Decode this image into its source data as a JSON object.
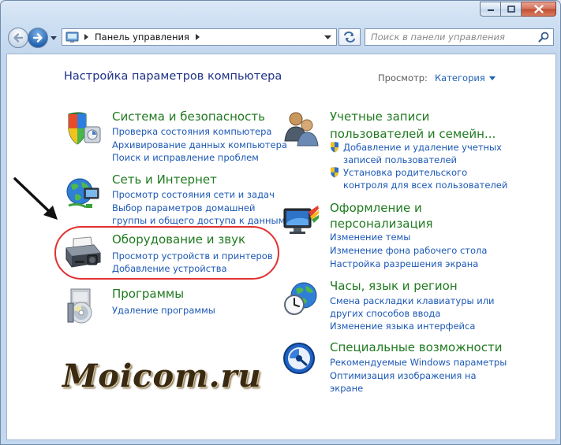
{
  "nav": {
    "address": "Панель управления",
    "search_placeholder": "Поиск в панели управления"
  },
  "header": {
    "title": "Настройка параметров компьютера",
    "viewby_label": "Просмотр:",
    "viewby_value": "Категория"
  },
  "left": [
    {
      "title": "Система и безопасность",
      "icon": "security-shield-icon",
      "links": [
        "Проверка состояния компьютера",
        "Архивирование данных компьютера",
        "Поиск и исправление проблем"
      ]
    },
    {
      "title": "Сеть и Интернет",
      "icon": "network-globe-icon",
      "links": [
        "Просмотр состояния сети и задач",
        "Выбор параметров домашней",
        "группы и общего доступа к данным"
      ]
    },
    {
      "title": "Оборудование и звук",
      "icon": "printer-icon",
      "links": [
        "Просмотр устройств и принтеров",
        "Добавление устройства"
      ]
    },
    {
      "title": "Программы",
      "icon": "programs-disc-icon",
      "links": [
        "Удаление программы"
      ]
    }
  ],
  "right": [
    {
      "title_lines": [
        "Учетные записи",
        "пользователей и семейн..."
      ],
      "icon": "users-icon",
      "links": [
        "Добавление и удаление учетных",
        "записей пользователей",
        "Установка родительского",
        "контроля для всех пользователей"
      ]
    },
    {
      "title_lines": [
        "Оформление и",
        "персонализация"
      ],
      "icon": "display-personalization-icon",
      "links": [
        "Изменение темы",
        "Изменение фона рабочего стола",
        "Настройка разрешения экрана"
      ]
    },
    {
      "title": "Часы, язык и регион",
      "icon": "clock-globe-icon",
      "links": [
        "Смена раскладки клавиатуры или",
        "других способов ввода",
        "Изменение языка интерфейса"
      ]
    },
    {
      "title": "Специальные возможности",
      "icon": "accessibility-icon",
      "links": [
        "Рекомендуемые Windows параметры",
        "Оптимизация изображения на",
        "экране"
      ]
    }
  ],
  "watermark": "Moicom.ru",
  "colors": {
    "category_title": "#207a20",
    "link": "#1c58b5",
    "header": "#1e3287",
    "highlight_oval": "#e23030"
  }
}
